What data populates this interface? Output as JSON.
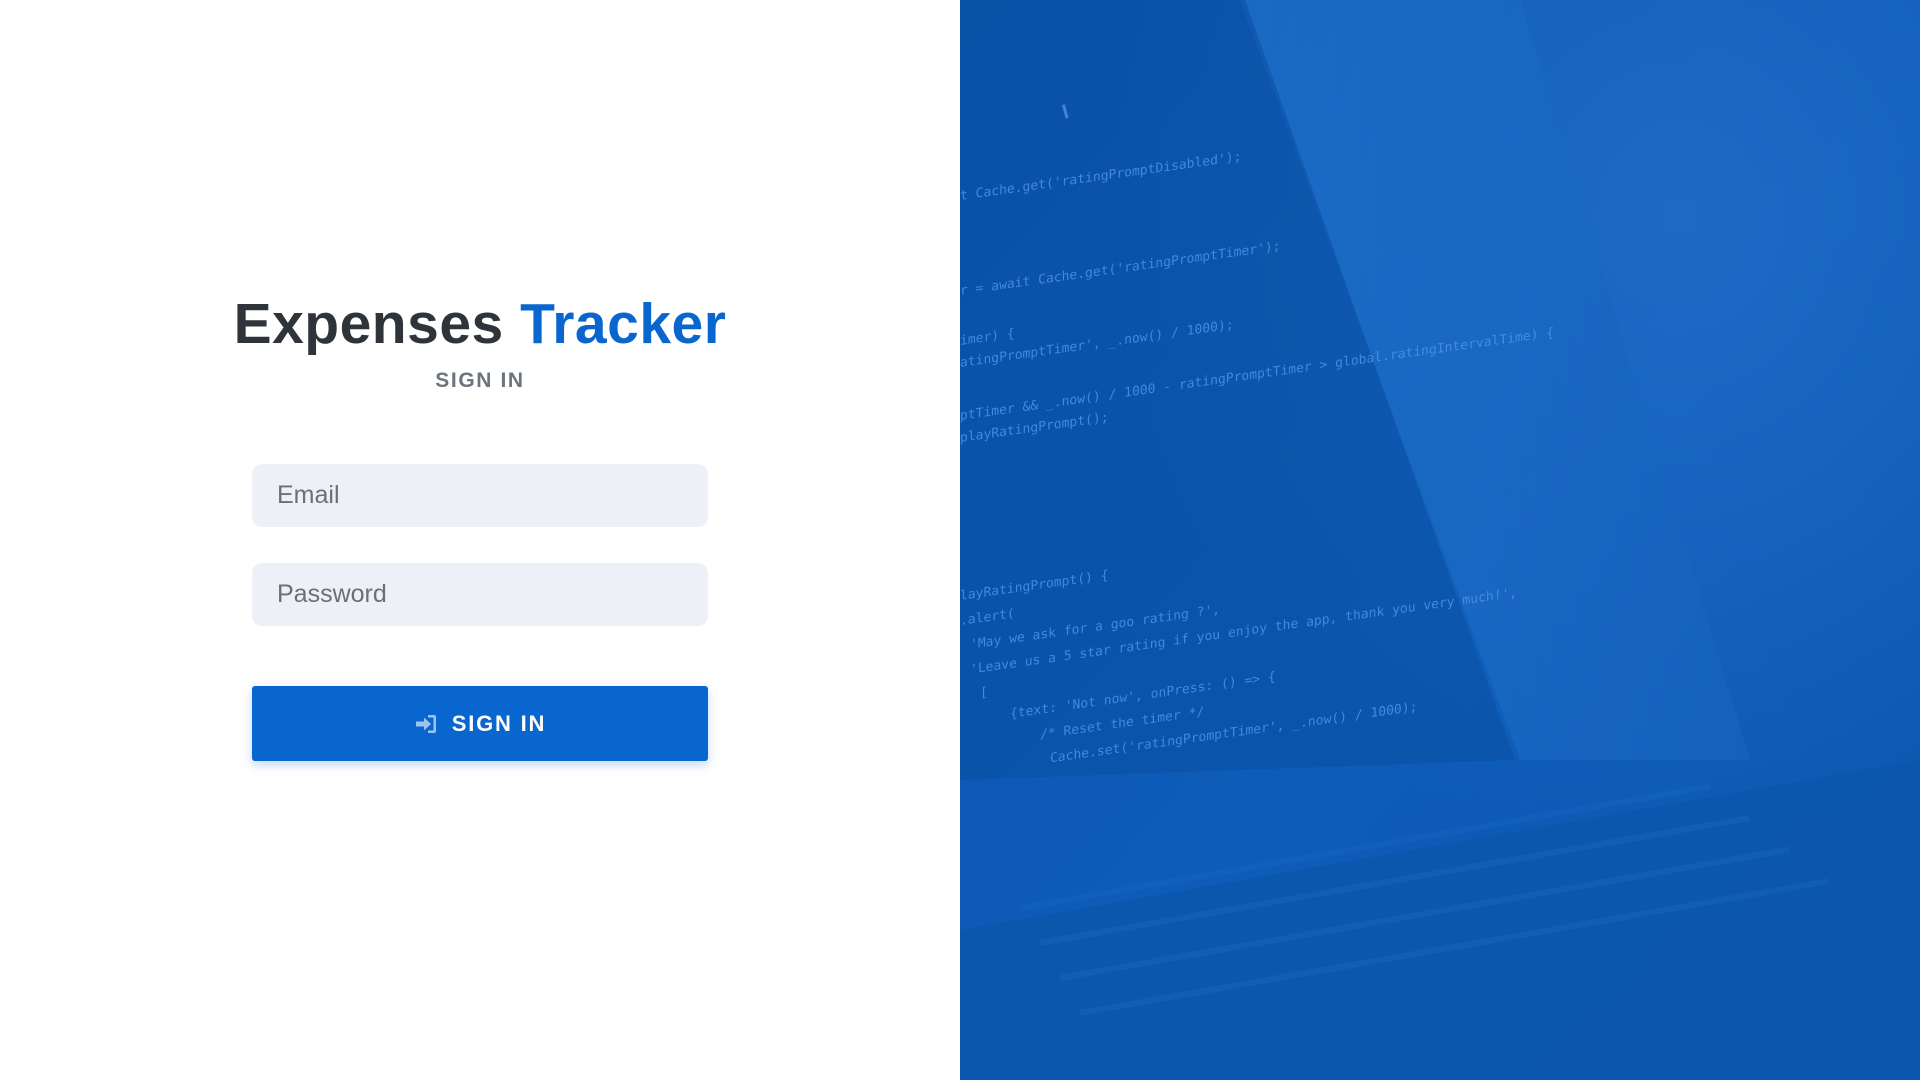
{
  "app": {
    "title_primary": "Expenses",
    "title_accent": "Tracker",
    "subtitle": "SIGN IN"
  },
  "form": {
    "email_placeholder": "Email",
    "email_value": "",
    "password_placeholder": "Password",
    "password_value": "",
    "submit_label": "SIGN IN",
    "submit_icon": "sign-in-icon"
  },
  "hero": {
    "image": "laptop-with-code-photo",
    "code_lines": [
      "t Cache.get('ratingPromptDisabled');",
      "r = await Cache.get('ratingPromptTimer');",
      "imer) {",
      "atingPromptTimer', _.now() / 1000);",
      "ptTimer && _.now() / 1000 - ratingPromptTimer > global.ratingIntervalTime) {",
      "playRatingPrompt();",
      "layRatingPrompt() {",
      ".alert(",
      "'May we ask for a goo rating ?',",
      "'Leave us a 5 star rating if you enjoy the app, thank you very much!',",
      "[",
      "{text: 'Not now', onPress: () => {",
      "/* Reset the timer */",
      "Cache.set('ratingPromptTimer', _.now() / 1000);"
    ]
  },
  "colors": {
    "brand_blue": "#0a66cf",
    "title_dark": "#2f343b",
    "subtitle_gray": "#6d747d",
    "input_bg": "#edf0f6",
    "hero_overlay": "#0b5bb8"
  }
}
